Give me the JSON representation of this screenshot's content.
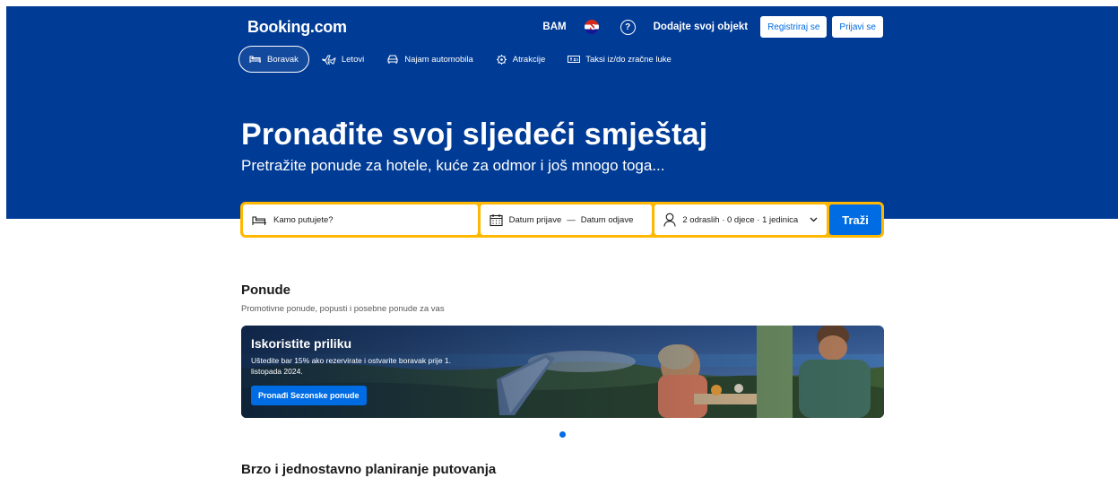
{
  "header": {
    "logo": "Booking.com",
    "currency": "BAM",
    "list_property": "Dodajte svoj objekt",
    "register": "Registriraj se",
    "signin": "Prijavi se",
    "help_icon": "help-circle-icon"
  },
  "nav": {
    "items": [
      {
        "label": "Boravak",
        "icon": "bed-icon",
        "active": true
      },
      {
        "label": "Letovi",
        "icon": "plane-icon",
        "active": false
      },
      {
        "label": "Najam automobila",
        "icon": "car-icon",
        "active": false
      },
      {
        "label": "Atrakcije",
        "icon": "attractions-icon",
        "active": false
      },
      {
        "label": "Taksi iz/do zračne luke",
        "icon": "taxi-icon",
        "active": false
      }
    ]
  },
  "hero": {
    "title": "Pronađite svoj sljedeći smještaj",
    "subtitle": "Pretražite ponude za hotele, kuće za odmor i još mnogo toga..."
  },
  "search": {
    "destination_placeholder": "Kamo putujete?",
    "checkin": "Datum prijave",
    "dash": "—",
    "checkout": "Datum odjave",
    "guests": "2 odraslih · 0 djece · 1 jedinica",
    "button": "Traži"
  },
  "offers": {
    "title": "Ponude",
    "subtitle": "Promotivne ponude, popusti i posebne ponude za vas",
    "promo": {
      "title": "Iskoristite priliku",
      "description": "Uštedite bar 15% ako rezervirate i ostvarite boravak prije 1. listopada 2024.",
      "button": "Pronađi Sezonske ponude"
    }
  },
  "planning": {
    "title": "Brzo i jednostavno planiranje putovanja"
  },
  "colors": {
    "brand_blue": "#003b95",
    "action_blue": "#006ce4",
    "search_yellow": "#ffb700"
  }
}
